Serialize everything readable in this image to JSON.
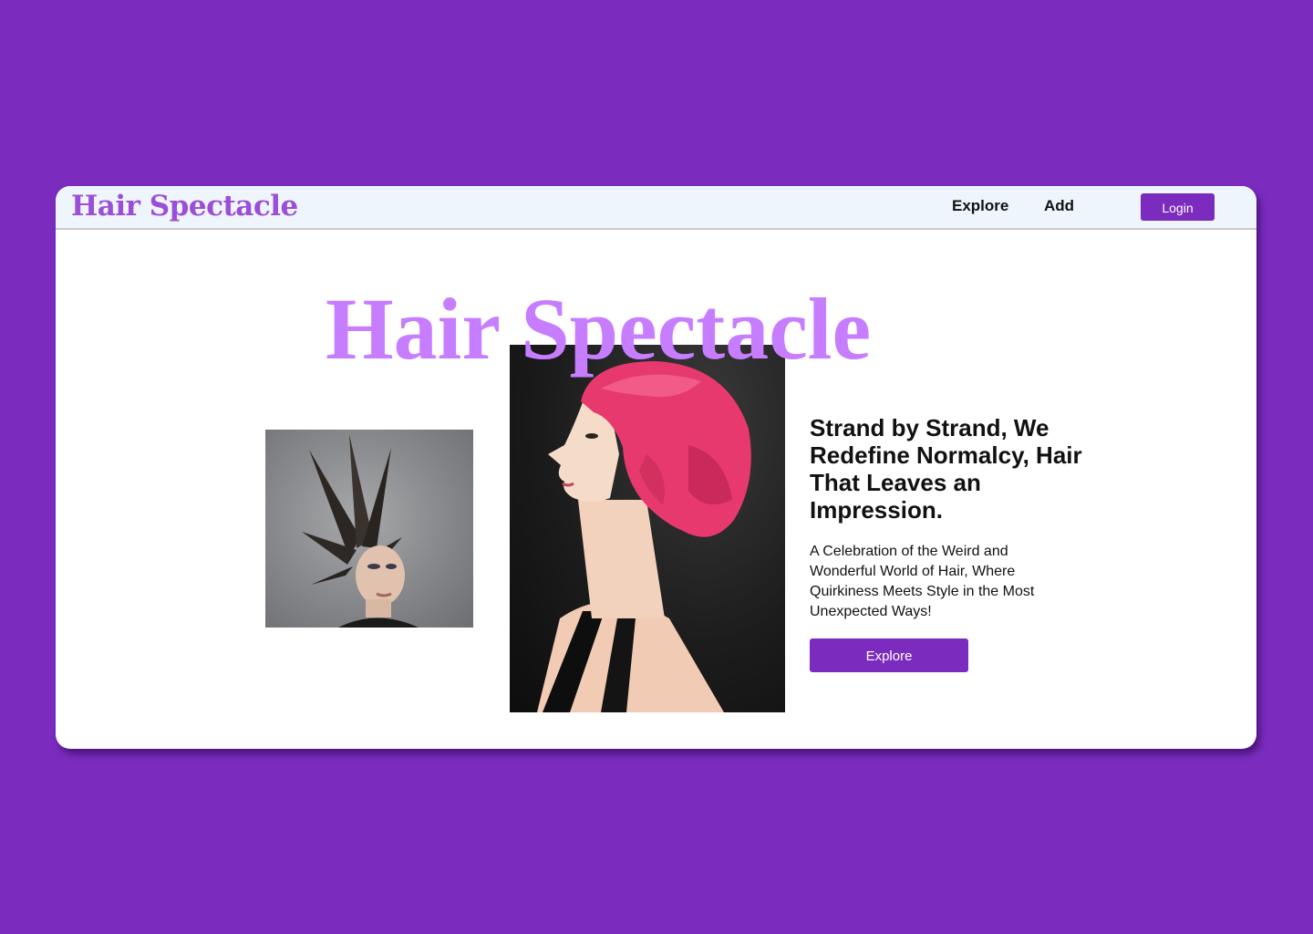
{
  "navbar": {
    "brand": "Hair Spectacle",
    "links": [
      "Explore",
      "Add"
    ],
    "login_label": "Login"
  },
  "hero": {
    "title": "Hair Spectacle",
    "tagline": "Strand by Strand, We Redefine Normalcy, Hair That Leaves an Impression.",
    "description": "A Celebration of the Weird and Wonderful World of Hair, Where Quirkiness Meets Style in the Most Unexpected Ways!",
    "cta_label": "Explore"
  },
  "images": {
    "left": "photo-spiky-hair-model",
    "center": "photo-pink-bob-profile"
  },
  "colors": {
    "background": "#7b2cbf",
    "accent": "#7b2cbf",
    "brand": "#9b4fd6",
    "hero_title": "#c77dff",
    "navbar_bg": "#eef5fc",
    "text": "#111111"
  }
}
